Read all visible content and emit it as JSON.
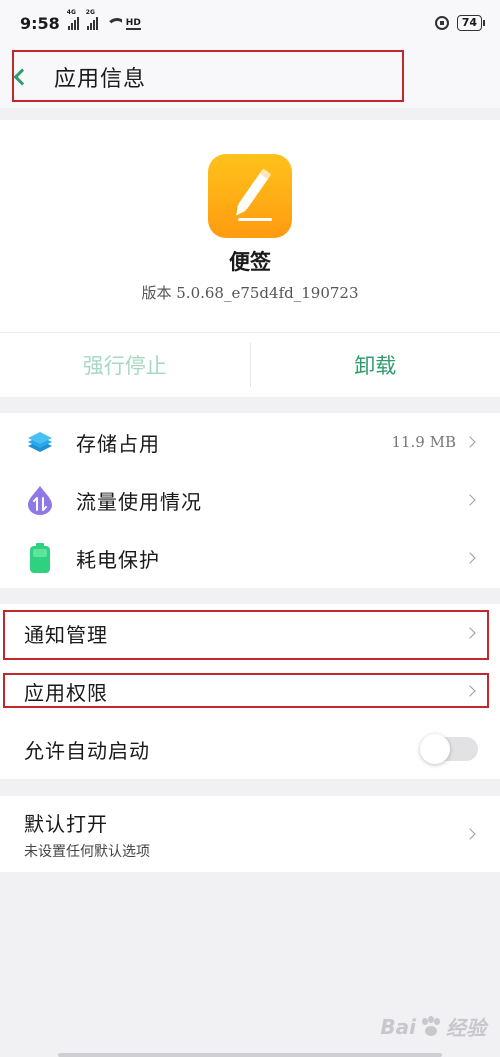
{
  "status_bar": {
    "time": "9:58",
    "signal1_tag": "4G",
    "signal2_tag": "2G",
    "hd_label": "HD",
    "battery": "74"
  },
  "header": {
    "title": "应用信息"
  },
  "app": {
    "name": "便签",
    "version": "版本 5.0.68_e75d4fd_190723",
    "icon": "pencil-note-icon",
    "icon_colors": [
      "#ffc21c",
      "#ff9b0f"
    ]
  },
  "actions": {
    "force_stop": "强行停止",
    "uninstall": "卸载"
  },
  "usage": {
    "storage_label": "存储占用",
    "storage_value": "11.9 MB",
    "traffic_label": "流量使用情况",
    "power_label": "耗电保护"
  },
  "permissions": {
    "notification_label": "通知管理",
    "app_permissions_label": "应用权限",
    "autostart_label": "允许自动启动",
    "autostart_enabled": false
  },
  "defaults": {
    "label": "默认打开",
    "sub": "未设置任何默认选项"
  },
  "watermark": {
    "text": "Bai",
    "suffix": "经验"
  },
  "colors": {
    "accent": "#2e9c6c",
    "accent_disabled": "#a7d8c3",
    "highlight": "#c0282b"
  }
}
